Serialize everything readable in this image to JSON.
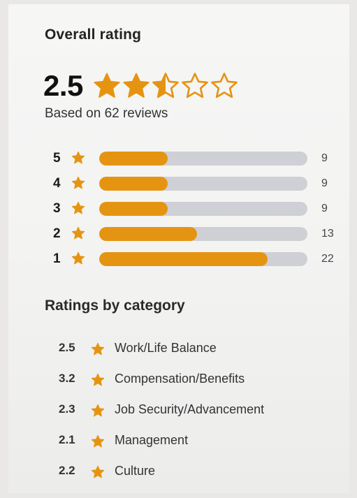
{
  "header": {
    "title": "Overall rating"
  },
  "overall": {
    "average": "2.5",
    "average_numeric": 2.5,
    "max_stars": 5,
    "based_on": "Based on 62 reviews"
  },
  "distribution": [
    {
      "stars": "5",
      "count": "9",
      "share": 0.33
    },
    {
      "stars": "4",
      "count": "9",
      "share": 0.33
    },
    {
      "stars": "3",
      "count": "9",
      "share": 0.33
    },
    {
      "stars": "2",
      "count": "13",
      "share": 0.47
    },
    {
      "stars": "1",
      "count": "22",
      "share": 0.81
    }
  ],
  "categories_section": {
    "title": "Ratings by category",
    "items": [
      {
        "value": "2.5",
        "label": "Work/Life Balance"
      },
      {
        "value": "3.2",
        "label": "Compensation/Benefits"
      },
      {
        "value": "2.3",
        "label": "Job Security/Advancement"
      },
      {
        "value": "2.1",
        "label": "Management"
      },
      {
        "value": "2.2",
        "label": "Culture"
      }
    ]
  },
  "colors": {
    "accent": "#e59412",
    "track": "#cfd0d5",
    "star_outline": "#e59412"
  },
  "icons": {
    "star": "star-icon",
    "star_half": "star-half-icon",
    "star_empty": "star-empty-icon"
  }
}
